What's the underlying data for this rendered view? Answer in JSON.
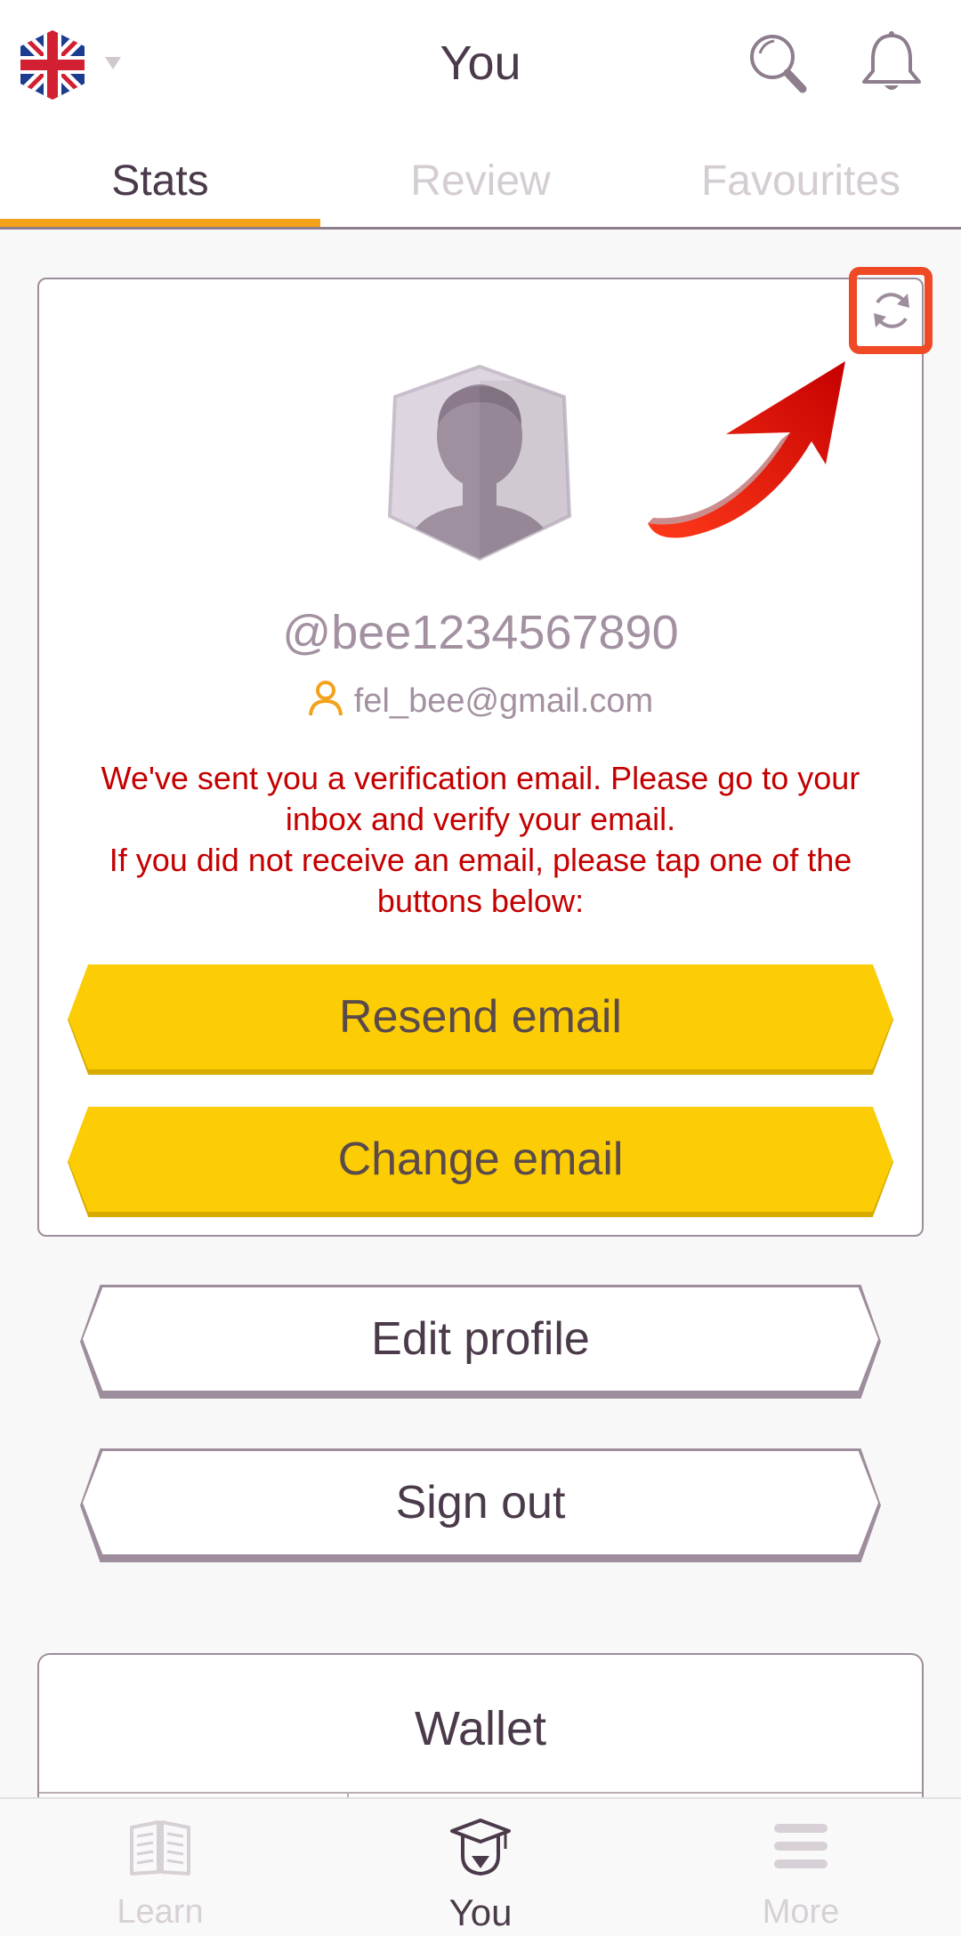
{
  "header": {
    "title": "You",
    "language_flag": "uk-flag-icon"
  },
  "tabs": [
    {
      "label": "Stats",
      "active": true
    },
    {
      "label": "Review",
      "active": false
    },
    {
      "label": "Favourites",
      "active": false
    }
  ],
  "profile": {
    "username": "@bee1234567890",
    "email": "fel_bee@gmail.com",
    "verification_line1": "We've sent you a verification email. Please go to your inbox and verify your email.",
    "verification_line2": "If you did not receive an email, please tap one of the buttons below:",
    "resend_label": "Resend email",
    "change_label": "Change email"
  },
  "actions": {
    "edit_profile_label": "Edit profile",
    "sign_out_label": "Sign out"
  },
  "wallet": {
    "title": "Wallet"
  },
  "bottom_nav": [
    {
      "label": "Learn",
      "icon": "book-icon",
      "active": false
    },
    {
      "label": "You",
      "icon": "graduation-cap-icon",
      "active": true
    },
    {
      "label": "More",
      "icon": "menu-icon",
      "active": false
    }
  ],
  "colors": {
    "accent": "#f2a21b",
    "primary_button": "#fccc05",
    "error_text": "#c40000",
    "highlight": "#ef4a25"
  }
}
